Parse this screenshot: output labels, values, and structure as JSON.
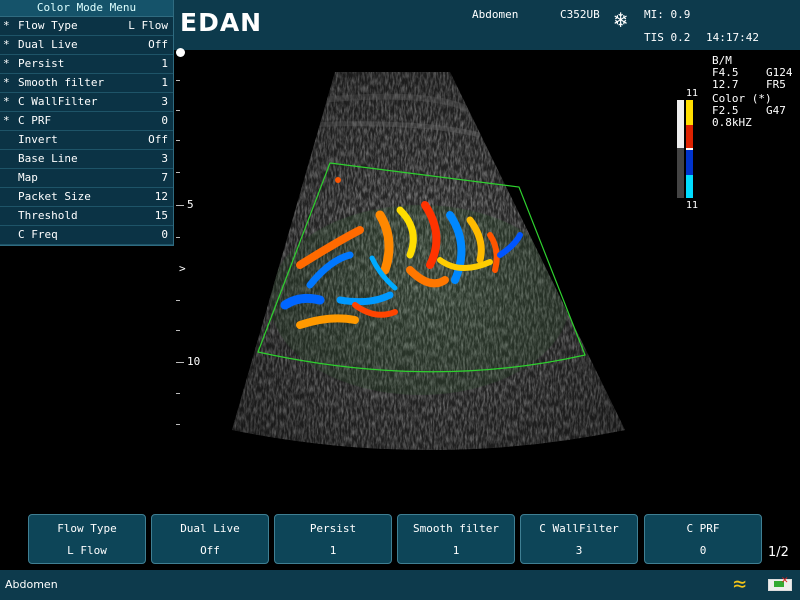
{
  "header": {
    "brand": "EDAN",
    "exam": "Abdomen",
    "probe": "C352UB",
    "mi": "MI: 0.9",
    "tis": "TIS 0.2",
    "time": "14:17:42",
    "freeze_icon": "snowflake-icon"
  },
  "menu": {
    "title": "Color Mode Menu",
    "items": [
      {
        "star": "*",
        "label": "Flow Type",
        "value": "L Flow"
      },
      {
        "star": "*",
        "label": "Dual Live",
        "value": "Off"
      },
      {
        "star": "*",
        "label": "Persist",
        "value": "1"
      },
      {
        "star": "*",
        "label": "Smooth filter",
        "value": "1"
      },
      {
        "star": "*",
        "label": "C WallFilter",
        "value": "3"
      },
      {
        "star": "*",
        "label": "C PRF",
        "value": "0"
      },
      {
        "star": "",
        "label": "Invert",
        "value": "Off"
      },
      {
        "star": "",
        "label": "Base Line",
        "value": "3"
      },
      {
        "star": "",
        "label": "Map",
        "value": "7"
      },
      {
        "star": "",
        "label": "Packet Size",
        "value": "12"
      },
      {
        "star": "",
        "label": "Threshold",
        "value": "15"
      },
      {
        "star": "",
        "label": "C Freq",
        "value": "0"
      }
    ]
  },
  "info": {
    "bm_label": "B/M",
    "f_bm": "F4.5",
    "g_bm": "G124",
    "depth_val": "12.7",
    "frame_rate": "FR5",
    "color_label": "Color (*)",
    "f_color": "F2.5",
    "g_color": "G47",
    "prf": "0.8kHZ",
    "color_bar_top": "11",
    "color_bar_bottom": "11"
  },
  "ruler": {
    "depth_5": "5",
    "depth_10": "10",
    "focus_marker": ">"
  },
  "softkeys": [
    {
      "label": "Flow Type",
      "value": "L Flow"
    },
    {
      "label": "Dual Live",
      "value": "Off"
    },
    {
      "label": "Persist",
      "value": "1"
    },
    {
      "label": "Smooth filter",
      "value": "1"
    },
    {
      "label": "C WallFilter",
      "value": "3"
    },
    {
      "label": "C PRF",
      "value": "0"
    }
  ],
  "page_indicator": "1/2",
  "status": {
    "text": "Abdomen",
    "wave_icon": "wave-icon",
    "battery_icon": "battery-icon"
  },
  "colors": {
    "panel_bg": "#0d3a4c",
    "roi_green": "#2ed12e",
    "flow_red": "#ff3300",
    "flow_blue": "#0066ff"
  }
}
